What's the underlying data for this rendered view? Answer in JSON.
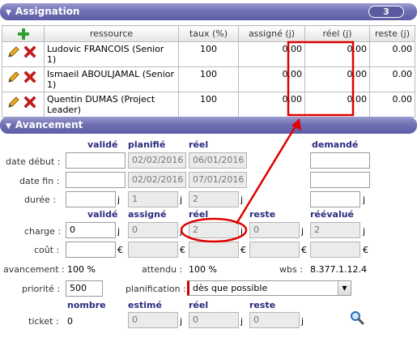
{
  "assignation": {
    "title": "Assignation",
    "count": "3",
    "columns": [
      "ressource",
      "taux (%)",
      "assigné (j)",
      "réel (j)",
      "reste (j)"
    ],
    "rows": [
      {
        "ressource": "Ludovic FRANCOIS (Senior 1)",
        "taux": "100",
        "assigne": "0.00",
        "reel": "0.00",
        "reste": "0.00"
      },
      {
        "ressource": "Ismaeil ABOULJAMAL (Senior 1)",
        "taux": "100",
        "assigne": "0.00",
        "reel": "0.00",
        "reste": "0.00"
      },
      {
        "ressource": "Quentin DUMAS (Project Leader)",
        "taux": "100",
        "assigne": "0.00",
        "reel": "0.00",
        "reste": "0.00"
      }
    ]
  },
  "avancement": {
    "title": "Avancement",
    "dates_headers": {
      "valide": "validé",
      "planifie": "planifié",
      "reel": "réel",
      "demande": "demandé"
    },
    "date_debut": {
      "label": "date début :",
      "valide": "",
      "planifie": "02/02/2016",
      "reel": "06/01/2016",
      "demande": ""
    },
    "date_fin": {
      "label": "date fin :",
      "valide": "",
      "planifie": "02/02/2016",
      "reel": "07/01/2016",
      "demande": ""
    },
    "duree": {
      "label": "durée :",
      "valide": "",
      "planifie": "1",
      "reel": "2",
      "demande": "",
      "unit": "j"
    },
    "work_headers": {
      "valide": "validé",
      "assigne": "assigné",
      "reel": "réel",
      "reste": "reste",
      "reevalue": "réévalué"
    },
    "charge": {
      "label": "charge :",
      "valide": "0",
      "assigne": "0",
      "reel": "2",
      "reste": "0",
      "reevalue": "2",
      "unit": "j"
    },
    "cout": {
      "label": "coût :",
      "valide": "",
      "assigne": "",
      "reel": "",
      "reste": "",
      "reevalue": "",
      "unit": "€"
    },
    "avancement_label": "avancement :",
    "avancement_value": "100 %",
    "attendu_label": "attendu :",
    "attendu_value": "100 %",
    "wbs_label": "wbs :",
    "wbs_value": "8.377.1.12.4",
    "priorite_label": "priorité :",
    "priorite_value": "500",
    "planification_label": "planification :",
    "planification_value": "dès que possible",
    "ticket_headers": {
      "nombre": "nombre",
      "estime": "estimé",
      "reel": "réel",
      "reste": "reste"
    },
    "ticket": {
      "label": "ticket :",
      "nombre": "0",
      "estime": "0",
      "reel": "0",
      "reste": "0",
      "unit": "j"
    }
  },
  "colors": {
    "header_bg": "#6e6eb3",
    "highlight": "#e00000",
    "label_blue": "#2b2b80"
  }
}
